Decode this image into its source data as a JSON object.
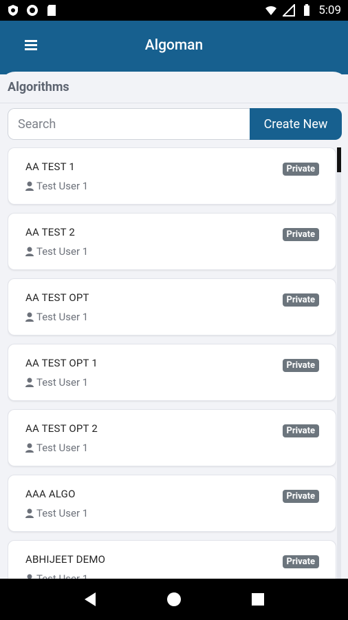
{
  "status_bar": {
    "time": "5:09"
  },
  "app_bar": {
    "title": "Algoman"
  },
  "section": {
    "title": "Algorithms"
  },
  "search": {
    "placeholder": "Search",
    "create_label": "Create New"
  },
  "algorithms": [
    {
      "name": "AA TEST 1",
      "owner": "Test User 1",
      "visibility": "Private"
    },
    {
      "name": "AA TEST 2",
      "owner": "Test User 1",
      "visibility": "Private"
    },
    {
      "name": "AA TEST OPT",
      "owner": "Test User 1",
      "visibility": "Private"
    },
    {
      "name": "AA TEST OPT 1",
      "owner": "Test User 1",
      "visibility": "Private"
    },
    {
      "name": "AA TEST OPT 2",
      "owner": "Test User 1",
      "visibility": "Private"
    },
    {
      "name": "AAA ALGO",
      "owner": "Test User 1",
      "visibility": "Private"
    },
    {
      "name": "ABHIJEET DEMO",
      "owner": "Test User 1",
      "visibility": "Private"
    }
  ],
  "colors": {
    "primary": "#17608f",
    "badge": "#6c757d",
    "background": "#f2f3f7"
  }
}
